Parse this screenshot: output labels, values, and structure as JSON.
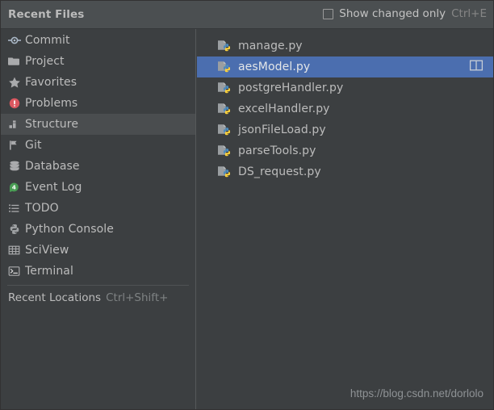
{
  "header": {
    "title": "Recent Files",
    "checkbox": {
      "icon": "checkbox-unchecked-icon",
      "checked": false,
      "label": "Show changed only",
      "shortcut": "Ctrl+E"
    }
  },
  "sidebar": {
    "items": [
      {
        "label": "Commit",
        "icon": "commit-icon",
        "selected": false
      },
      {
        "label": "Project",
        "icon": "folder-icon",
        "selected": false
      },
      {
        "label": "Favorites",
        "icon": "star-icon",
        "selected": false
      },
      {
        "label": "Problems",
        "icon": "error-circle-icon",
        "selected": false
      },
      {
        "label": "Structure",
        "icon": "structure-icon",
        "selected": true
      },
      {
        "label": "Git",
        "icon": "git-branch-icon",
        "selected": false
      },
      {
        "label": "Database",
        "icon": "database-icon",
        "selected": false
      },
      {
        "label": "Event Log",
        "icon": "event-log-icon",
        "selected": false,
        "badge": "4"
      },
      {
        "label": "TODO",
        "icon": "todo-list-icon",
        "selected": false
      },
      {
        "label": "Python Console",
        "icon": "python-icon",
        "selected": false
      },
      {
        "label": "SciView",
        "icon": "sciview-grid-icon",
        "selected": false
      },
      {
        "label": "Terminal",
        "icon": "terminal-icon",
        "selected": false
      }
    ],
    "recent_locations": {
      "label": "Recent Locations",
      "shortcut": "Ctrl+Shift+"
    }
  },
  "files": {
    "items": [
      {
        "name": "manage.py",
        "icon": "python-file-icon",
        "selected": false,
        "error": false
      },
      {
        "name": "aesModel.py",
        "icon": "python-file-icon",
        "selected": true,
        "error": false,
        "action_icon": "split-view-icon"
      },
      {
        "name": "postgreHandler.py",
        "icon": "python-file-icon",
        "selected": false,
        "error": true
      },
      {
        "name": "excelHandler.py",
        "icon": "python-file-icon",
        "selected": false,
        "error": false
      },
      {
        "name": "jsonFileLoad.py",
        "icon": "python-file-icon",
        "selected": false,
        "error": false
      },
      {
        "name": "parseTools.py",
        "icon": "python-file-icon",
        "selected": false,
        "error": false
      },
      {
        "name": "DS_request.py",
        "icon": "python-file-icon",
        "selected": false,
        "error": false
      }
    ]
  },
  "watermark": {
    "text": "https://blog.csdn.net/dorlolo"
  },
  "colors": {
    "background": "#3c3f41",
    "header_background": "#4b4f51",
    "selection_blue": "#4b6eaf",
    "hover_gray": "#4a4d4f",
    "text": "#bcbcbc",
    "muted_text": "#868686",
    "error_red": "#db5860",
    "badge_green": "#499c54",
    "python_blue": "#4b8bbe",
    "python_yellow": "#ffd43b"
  }
}
